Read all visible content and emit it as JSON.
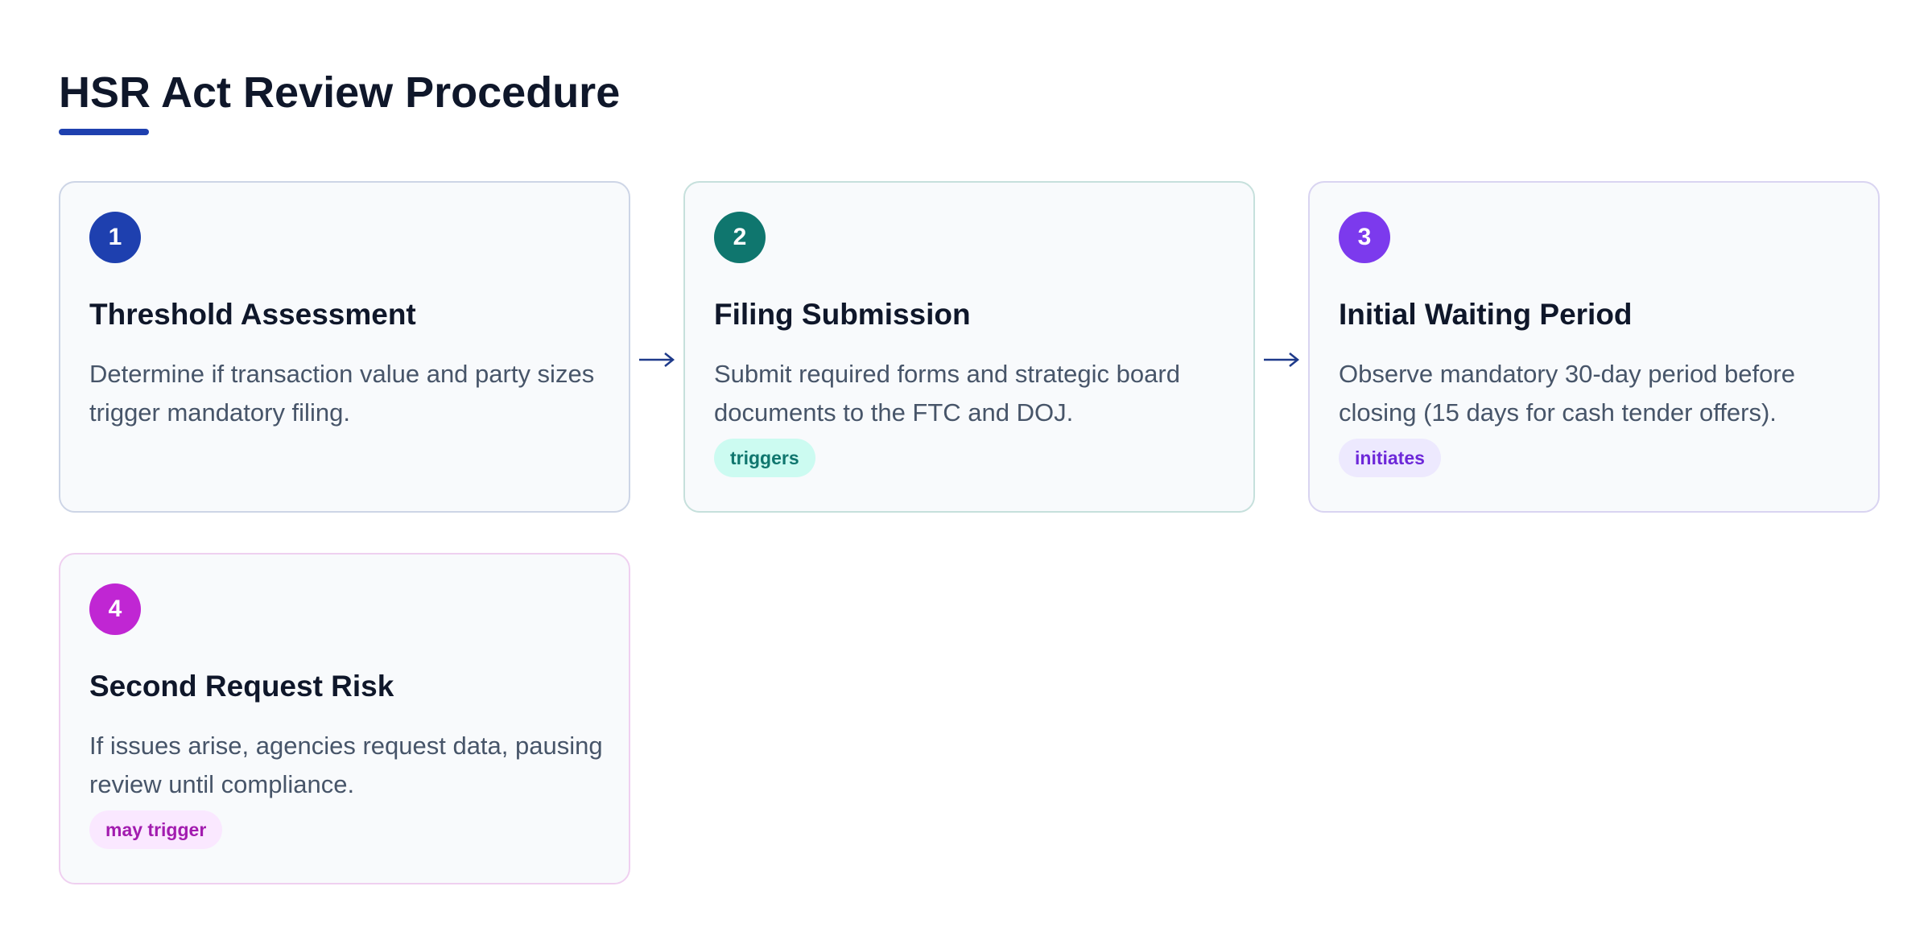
{
  "title": "HSR Act Review Procedure",
  "accent_color": "#1e40af",
  "steps": [
    {
      "number": "1",
      "title": "Threshold Assessment",
      "description": "Determine if transaction value and party sizes trigger mandatory filing.",
      "badge": "",
      "color": "#1e40af"
    },
    {
      "number": "2",
      "title": "Filing Submission",
      "description": "Submit required forms and strategic board documents to the FTC and DOJ.",
      "badge": "triggers",
      "color": "#0f766e"
    },
    {
      "number": "3",
      "title": "Initial Waiting Period",
      "description": "Observe mandatory 30-day period before closing (15 days for cash tender offers).",
      "badge": "initiates",
      "color": "#7c3aed"
    },
    {
      "number": "4",
      "title": "Second Request Risk",
      "description": "If issues arise, agencies request data, pausing review until compliance.",
      "badge": "may trigger",
      "color": "#c026d3"
    }
  ],
  "connectors": [
    {
      "from": "1",
      "to": "2",
      "icon": "arrow-right-icon"
    },
    {
      "from": "2",
      "to": "3",
      "icon": "arrow-right-icon"
    }
  ]
}
